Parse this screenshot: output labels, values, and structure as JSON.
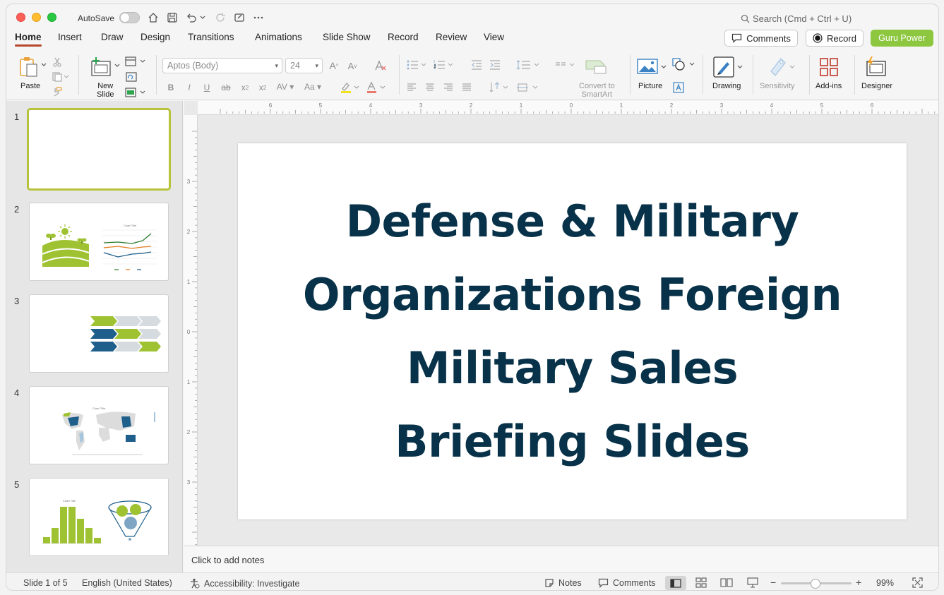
{
  "titlebar": {
    "autosave_label": "AutoSave",
    "search_placeholder": "Search (Cmd + Ctrl + U)"
  },
  "tabs": [
    "Home",
    "Insert",
    "Draw",
    "Design",
    "Transitions",
    "Animations",
    "Slide Show",
    "Record",
    "Review",
    "View"
  ],
  "actions": {
    "comments": "Comments",
    "record": "Record",
    "guru": "Guru Power"
  },
  "ribbon": {
    "paste": "Paste",
    "new_slide_line1": "New",
    "new_slide_line2": "Slide",
    "font_name": "Aptos (Body)",
    "font_size": "24",
    "convert_line1": "Convert to",
    "convert_line2": "SmartArt",
    "picture": "Picture",
    "drawing": "Drawing",
    "sensitivity": "Sensitivity",
    "addins": "Add-ins",
    "designer": "Designer"
  },
  "thumbnails": [
    "1",
    "2",
    "3",
    "4",
    "5"
  ],
  "slide": {
    "title_lines": [
      "Defense & Military",
      "Organizations Foreign",
      "Military Sales",
      "Briefing Slides"
    ]
  },
  "notes_placeholder": "Click to add notes",
  "status": {
    "slide_count": "Slide 1 of 5",
    "language": "English (United States)",
    "accessibility": "Accessibility: Investigate",
    "notes": "Notes",
    "comments": "Comments",
    "zoom": "99%"
  },
  "colors": {
    "accent": "#b7472a",
    "guru": "#8dc63f",
    "title": "#083249",
    "thumb_selected": "#b6c33b"
  }
}
